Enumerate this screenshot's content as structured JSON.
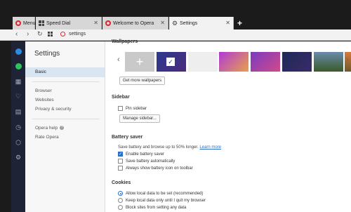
{
  "tabs": [
    {
      "label": "Menu",
      "icon": "opera-logo-icon"
    },
    {
      "label": "Speed Dial",
      "icon": "speed-dial-icon"
    },
    {
      "label": "Welcome to Opera",
      "icon": "opera-logo-icon"
    },
    {
      "label": "Settings",
      "icon": "gear-icon"
    }
  ],
  "address": {
    "url": "settings"
  },
  "settings_sidebar": {
    "title": "Settings",
    "items": [
      "Basic",
      "Browser",
      "Websites",
      "Privacy & security",
      "Opera help",
      "Rate Opera"
    ]
  },
  "wallpapers": {
    "title": "Wallpapers",
    "more_label": "Get more wallpapers",
    "colors": [
      "#c9c9c9",
      "#2b3a8f",
      "#eeeeee",
      "#b03ad8",
      "#7a3bc0",
      "#1e2a55",
      "#3a6a8a",
      "#6b8a3a",
      "#c25a2a"
    ]
  },
  "sidebar_section": {
    "title": "Sidebar",
    "show_sidebar": "Pin sidebar",
    "manage_label": "Manage sidebar..."
  },
  "battery": {
    "title": "Battery saver",
    "desc": "Save battery and browse up to 50% longer.",
    "learn_more": "Learn more",
    "options": [
      "Enable battery saver",
      "Save battery automatically",
      "Always show battery icon on toolbar"
    ]
  },
  "cookies": {
    "title": "Cookies",
    "options": [
      "Allow local data to be set (recommended)",
      "Keep local data only until I quit my browser",
      "Block sites from setting any data"
    ]
  }
}
